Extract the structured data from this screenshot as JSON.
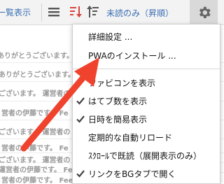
{
  "toolbar": {
    "list_view_label": "一覧表示",
    "sort_label": "未読のみ（昇順）",
    "icons": [
      "list-icon",
      "sort-descending-icon",
      "sort-ascending-icon",
      "gear-icon"
    ]
  },
  "background_rows": [
    "ありがとうございます。管",
    "ありがとうございます。",
    "ございます。 運営者の",
    "営者の伊藤です。 Fe",
    "ございます。 運営者の",
    "営者の伊藤です。 Fe",
    "ございます。 運営者の",
    "運営者の伊藤です。 Fe",
    "営者の伊藤です。 Feedeen"
  ],
  "menu": {
    "items": [
      {
        "label": "詳細設定 ...",
        "checked": false
      },
      {
        "label": "PWAのインストール ...",
        "checked": false
      },
      {
        "label": "ファビコンを表示",
        "checked": false
      },
      {
        "label": "はてブ数を表示",
        "checked": true
      },
      {
        "label": "日時を簡易表示",
        "checked": true
      },
      {
        "label": "定期的な自動リロード",
        "checked": false
      },
      {
        "label": "ｽｸﾛｰﾙで既読（展開表示のみ）",
        "checked": false
      },
      {
        "label": "リンクをBGタブで開く",
        "checked": true
      }
    ]
  },
  "colors": {
    "accent_link": "#3a6fb5",
    "sort_icon_red": "#d6453d",
    "arrow_red": "#f0432e"
  }
}
